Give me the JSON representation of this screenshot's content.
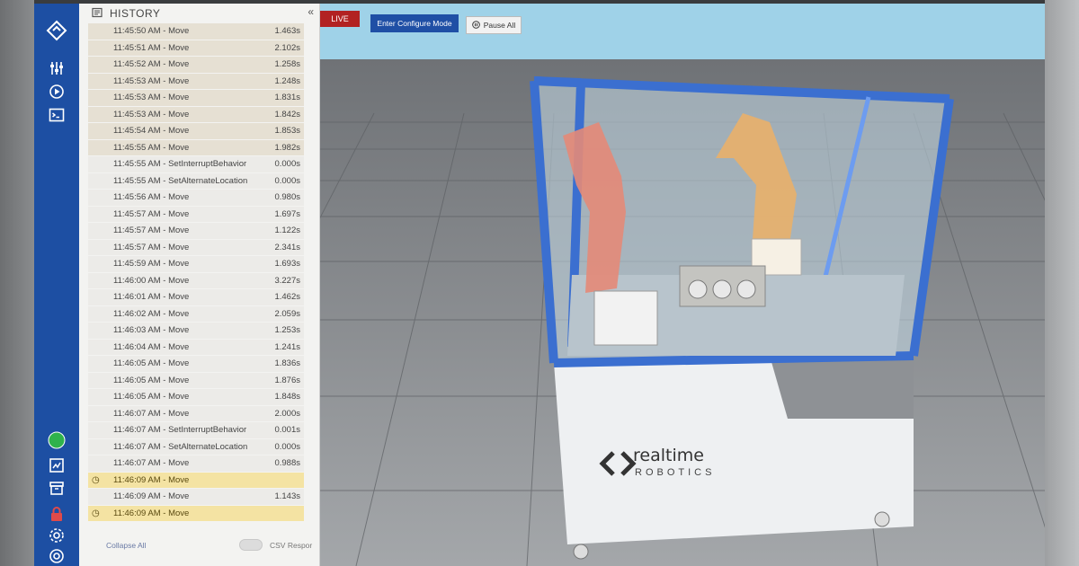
{
  "sidebar": {
    "icons": [
      "logo-icon",
      "sliders-icon",
      "play-circle-icon",
      "terminal-icon",
      "status-online-icon",
      "chart-icon",
      "archive-icon",
      "lock-icon",
      "gear-icon",
      "help-icon"
    ],
    "status_color": "#2fb24c"
  },
  "history": {
    "title": "HISTORY",
    "collapse_label": "«",
    "rows": [
      {
        "time": "11:45:50 AM - Move",
        "dur": "1.463s",
        "style": "tan"
      },
      {
        "time": "11:45:51 AM - Move",
        "dur": "2.102s",
        "style": "tan"
      },
      {
        "time": "11:45:52 AM - Move",
        "dur": "1.258s",
        "style": "tan"
      },
      {
        "time": "11:45:53 AM - Move",
        "dur": "1.248s",
        "style": "tan"
      },
      {
        "time": "11:45:53 AM - Move",
        "dur": "1.831s",
        "style": "tan"
      },
      {
        "time": "11:45:53 AM - Move",
        "dur": "1.842s",
        "style": "tan"
      },
      {
        "time": "11:45:54 AM - Move",
        "dur": "1.853s",
        "style": "tan"
      },
      {
        "time": "11:45:55 AM - Move",
        "dur": "1.982s",
        "style": "tan"
      },
      {
        "time": "11:45:55 AM - SetInterruptBehavior",
        "dur": "0.000s",
        "style": "plain"
      },
      {
        "time": "11:45:55 AM - SetAlternateLocation",
        "dur": "0.000s",
        "style": "plain"
      },
      {
        "time": "11:45:56 AM - Move",
        "dur": "0.980s",
        "style": "plain"
      },
      {
        "time": "11:45:57 AM - Move",
        "dur": "1.697s",
        "style": "plain"
      },
      {
        "time": "11:45:57 AM - Move",
        "dur": "1.122s",
        "style": "plain"
      },
      {
        "time": "11:45:57 AM - Move",
        "dur": "2.341s",
        "style": "plain"
      },
      {
        "time": "11:45:59 AM - Move",
        "dur": "1.693s",
        "style": "plain"
      },
      {
        "time": "11:46:00 AM - Move",
        "dur": "3.227s",
        "style": "plain"
      },
      {
        "time": "11:46:01 AM - Move",
        "dur": "1.462s",
        "style": "plain"
      },
      {
        "time": "11:46:02 AM - Move",
        "dur": "2.059s",
        "style": "plain"
      },
      {
        "time": "11:46:03 AM - Move",
        "dur": "1.253s",
        "style": "plain"
      },
      {
        "time": "11:46:04 AM - Move",
        "dur": "1.241s",
        "style": "plain"
      },
      {
        "time": "11:46:05 AM - Move",
        "dur": "1.836s",
        "style": "plain"
      },
      {
        "time": "11:46:05 AM - Move",
        "dur": "1.876s",
        "style": "plain"
      },
      {
        "time": "11:46:05 AM - Move",
        "dur": "1.848s",
        "style": "plain"
      },
      {
        "time": "11:46:07 AM - Move",
        "dur": "2.000s",
        "style": "plain"
      },
      {
        "time": "11:46:07 AM - SetInterruptBehavior",
        "dur": "0.001s",
        "style": "plain"
      },
      {
        "time": "11:46:07 AM - SetAlternateLocation",
        "dur": "0.000s",
        "style": "plain"
      },
      {
        "time": "11:46:07 AM - Move",
        "dur": "0.988s",
        "style": "plain"
      },
      {
        "time": "11:46:09 AM - Move",
        "dur": "",
        "style": "highlight"
      },
      {
        "time": "11:46:09 AM - Move",
        "dur": "1.143s",
        "style": "plain"
      },
      {
        "time": "11:46:09 AM - Move",
        "dur": "",
        "style": "highlight"
      }
    ],
    "footer": {
      "collapse_all": "Collapse All",
      "csv_label": "CSV Respor"
    }
  },
  "toolbar": {
    "live_label": "LIVE",
    "configure_label": "Enter Configure Mode",
    "pause_label": "Pause All"
  },
  "scene": {
    "brand_word": "realtime",
    "brand_sub": "ROBOTICS",
    "frame_color": "#3b6fd0",
    "robot_left_color": "#e48a78",
    "robot_right_color": "#e9b06a"
  }
}
